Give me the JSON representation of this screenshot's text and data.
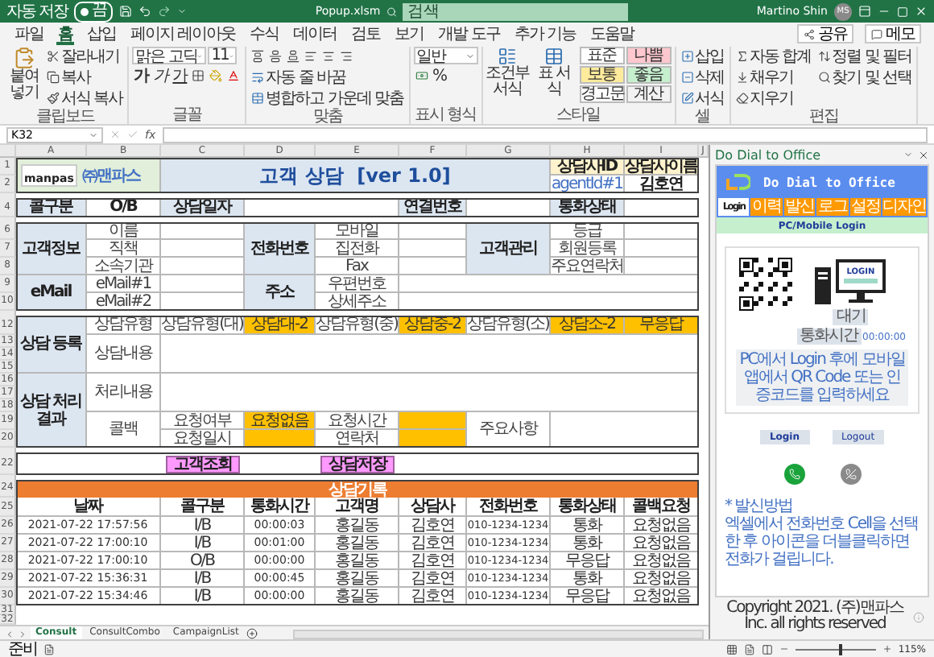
{
  "titlebar": {
    "autosave": {
      "label": "자동 저장",
      "state_text": "끔",
      "on": false
    },
    "filename": "Popup.xlsm",
    "search_placeholder": "검색",
    "user": "Martino Shin",
    "avatar": "MS"
  },
  "ribbon_tabs": [
    {
      "label": "파일",
      "selected": false
    },
    {
      "label": "홈",
      "selected": true
    },
    {
      "label": "삽입",
      "selected": false
    },
    {
      "label": "페이지 레이아웃",
      "selected": false
    },
    {
      "label": "수식",
      "selected": false
    },
    {
      "label": "데이터",
      "selected": false
    },
    {
      "label": "검토",
      "selected": false
    },
    {
      "label": "보기",
      "selected": false
    },
    {
      "label": "개발 도구",
      "selected": false
    },
    {
      "label": "추가 기능",
      "selected": false
    },
    {
      "label": "도움말",
      "selected": false
    }
  ],
  "ribbon_actions": [
    "공유",
    "메모"
  ],
  "ribbon_groups": [
    {
      "kind": "clipboard",
      "label": "클립보드",
      "big": "붙여넣기",
      "items": [
        "잘라내기",
        "복사",
        "서식 복사"
      ]
    },
    {
      "kind": "font",
      "label": "글꼴",
      "font": "맑은 고딕",
      "size": "11",
      "styles": [
        "가",
        "가",
        "가"
      ]
    },
    {
      "kind": "align",
      "label": "맞춤",
      "items": [
        "자동 줄 바꿈",
        "병합하고 가운데 맞춤"
      ]
    },
    {
      "kind": "number",
      "label": "표시 형식",
      "format": "일반",
      "symbols": [
        "%"
      ]
    },
    {
      "kind": "styles",
      "label": "스타일",
      "items": [
        "조건부 서식",
        "표 서식"
      ],
      "presets": [
        {
          "label": "표준",
          "color": "#ffffff"
        },
        {
          "label": "나쁨",
          "color": "#ffc7ce"
        },
        {
          "label": "보통",
          "color": "#ffeb9c"
        },
        {
          "label": "좋음",
          "color": "#c6efce"
        },
        {
          "label": "경고문",
          "color": "#ffffff"
        },
        {
          "label": "계산",
          "color": "#f2f2f2"
        }
      ]
    },
    {
      "kind": "cells",
      "label": "셀",
      "items": [
        "삽입",
        "삭제",
        "서식"
      ]
    },
    {
      "kind": "edit",
      "label": "편집",
      "items": [
        "자동 합계",
        "채우기",
        "지우기"
      ],
      "big": [
        "정렬 및 필터",
        "찾기 및 선택"
      ]
    }
  ],
  "formula_bar": {
    "cell": "K32",
    "function_label": "fx"
  },
  "sheet": {
    "column_headers": [
      "A",
      "B",
      "C",
      "D",
      "E",
      "F",
      "G",
      "H",
      "I",
      "J"
    ],
    "row_numbers": [
      "1",
      "2",
      "4",
      "6",
      "7",
      "8",
      "9",
      "10",
      "12",
      "13",
      "14",
      "15",
      "16",
      "17",
      "18",
      "19",
      "20",
      "22",
      "24",
      "25",
      "26",
      "27",
      "28",
      "29",
      "30",
      "31",
      "32"
    ],
    "logo": {
      "mark": "manpas",
      "name": "㈜맨파스"
    },
    "title": "고객 상담  [ver 1.0]",
    "cells": [
      {
        "kind": "agent_header",
        "text": "상담사ID"
      },
      {
        "kind": "agent_header",
        "text": "상담사이름"
      },
      {
        "kind": "agent_id",
        "text": "agentId#1"
      },
      {
        "kind": "value",
        "text": "김호연"
      },
      {
        "kind": "header",
        "text": "콜구분"
      },
      {
        "kind": "value",
        "text": "O/B"
      },
      {
        "kind": "header",
        "text": "상담일자"
      },
      {
        "kind": "header",
        "text": "연결번호"
      },
      {
        "kind": "header",
        "text": "통화상태"
      },
      {
        "kind": "header",
        "text": "고객정보"
      },
      {
        "kind": "label",
        "text": "이름"
      },
      {
        "kind": "label",
        "text": "직책"
      },
      {
        "kind": "label",
        "text": "소속기관"
      },
      {
        "kind": "header",
        "text": "전화번호"
      },
      {
        "kind": "label",
        "text": "모바일"
      },
      {
        "kind": "label",
        "text": "집전화"
      },
      {
        "kind": "label",
        "text": "Fax"
      },
      {
        "kind": "header",
        "text": "고객관리"
      },
      {
        "kind": "label",
        "text": "등급"
      },
      {
        "kind": "label",
        "text": "회원등록"
      },
      {
        "kind": "label",
        "text": "주요연락처"
      },
      {
        "kind": "header",
        "text": "eMail"
      },
      {
        "kind": "label",
        "text": "eMail#1"
      },
      {
        "kind": "label",
        "text": "eMail#2"
      },
      {
        "kind": "header",
        "text": "주소"
      },
      {
        "kind": "label",
        "text": "우편번호"
      },
      {
        "kind": "label",
        "text": "상세주소"
      },
      {
        "kind": "header",
        "text": "상담 등록"
      },
      {
        "kind": "label",
        "text": "상담유형"
      },
      {
        "kind": "label",
        "text": "상담유형(대)"
      },
      {
        "kind": "choice",
        "text": "상담대-2"
      },
      {
        "kind": "label",
        "text": "상담유형(중)"
      },
      {
        "kind": "choice",
        "text": "상담중-2"
      },
      {
        "kind": "label",
        "text": "상담유형(소)"
      },
      {
        "kind": "choice",
        "text": "상담소-2"
      },
      {
        "kind": "choice",
        "text": "무응답"
      },
      {
        "kind": "label",
        "text": "상담내용"
      },
      {
        "kind": "header",
        "text": "상담 처리 결과"
      },
      {
        "kind": "label",
        "text": "처리내용"
      },
      {
        "kind": "label",
        "text": "콜백"
      },
      {
        "kind": "label",
        "text": "요청여부"
      },
      {
        "kind": "choice",
        "text": "요청없음"
      },
      {
        "kind": "label",
        "text": "요청시간"
      },
      {
        "kind": "label",
        "text": "주요사항"
      },
      {
        "kind": "label",
        "text": "요청일시"
      },
      {
        "kind": "label",
        "text": "연락처"
      }
    ],
    "buttons": [
      "고객조회",
      "상담저장"
    ],
    "records": {
      "title": "상담기록",
      "columns": [
        "날짜",
        "콜구분",
        "통화시간",
        "고객명",
        "상담사",
        "전화번호",
        "통화상태",
        "콜백요청"
      ],
      "rows": [
        [
          "2021-07-22 17:57:56",
          "I/B",
          "00:00:03",
          "홍길동",
          "김호연",
          "010-1234-1234",
          "통화",
          "요청없음"
        ],
        [
          "2021-07-22 17:00:10",
          "I/B",
          "00:01:00",
          "홍길동",
          "김호연",
          "010-1234-1234",
          "통화",
          "요청없음"
        ],
        [
          "2021-07-22 17:00:10",
          "O/B",
          "00:00:00",
          "홍길동",
          "김호연",
          "010-1234-1234",
          "무응답",
          "요청없음"
        ],
        [
          "2021-07-22 15:36:31",
          "I/B",
          "00:00:45",
          "홍길동",
          "김호연",
          "010-1234-1234",
          "통화",
          "요청없음"
        ],
        [
          "2021-07-22 15:34:46",
          "I/B",
          "00:00:00",
          "홍길동",
          "김호연",
          "010-1234-1234",
          "무응답",
          "요청없음"
        ]
      ]
    }
  },
  "sheet_tabs": [
    {
      "label": "Consult",
      "selected": true
    },
    {
      "label": "ConsultCombo",
      "selected": false
    },
    {
      "label": "CampaignList",
      "selected": false
    }
  ],
  "pane": {
    "title": "Do Dial to Office",
    "banner": "Do Dial to Office",
    "tabs": [
      {
        "label": "Login",
        "selected": true
      },
      {
        "label": "이력",
        "selected": false
      },
      {
        "label": "발신",
        "selected": false
      },
      {
        "label": "로그",
        "selected": false
      },
      {
        "label": "설정",
        "selected": false
      },
      {
        "label": "디자인",
        "selected": false
      }
    ],
    "section": "PC/Mobile Login",
    "screen_text": "LOGIN",
    "status": "대기",
    "timer_label": "통화시간",
    "timer": "00:00:00",
    "hint": "PC에서 Login 후에 모바일앱에서 QR Code 또는 인증코드를 입력하세요",
    "buttons": [
      "Login",
      "Logout"
    ],
    "note_title": "* 발신방법",
    "note": "엑셀에서 전화번호 Cell을 선택한 후 아이콘을 더블클릭하면 전화가 걸립니다.",
    "copyright": "Copyright 2021. (주)맨파스 Inc. all rights reserved"
  },
  "status_bar": {
    "status": "준비",
    "zoom": {
      "level": 0.55,
      "reading": "115%"
    }
  }
}
